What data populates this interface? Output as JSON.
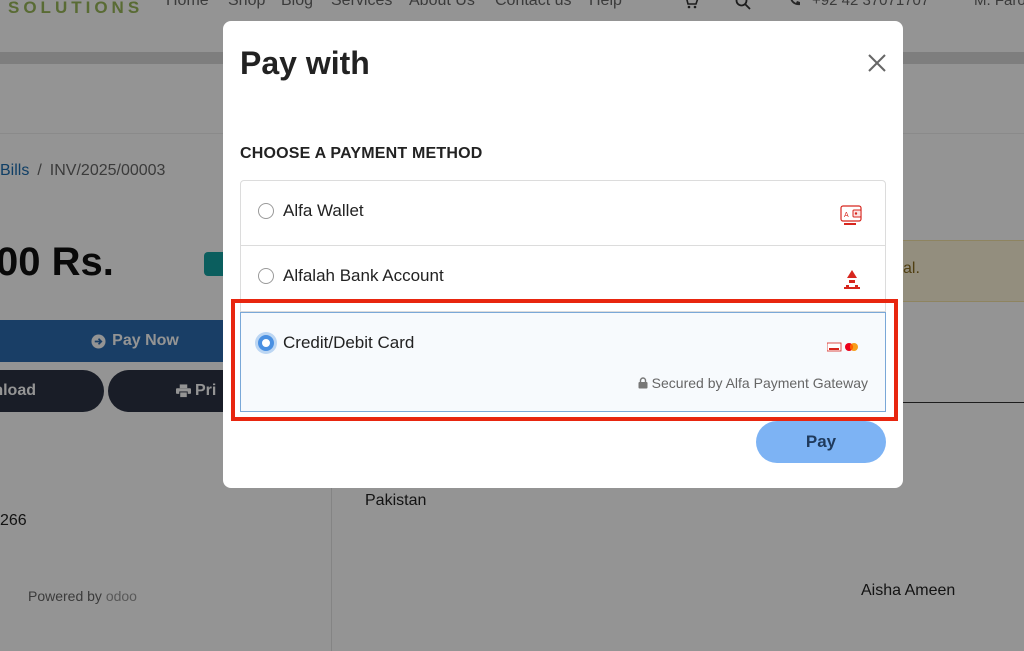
{
  "header": {
    "logo_text": "SOLUTIONS",
    "nav": [
      "Home",
      "Shop",
      "Blog",
      "Services",
      "About Us",
      "Contact us",
      "Help"
    ],
    "phone": "+92 42 37071707",
    "user": "M. Farooq"
  },
  "invoice_page": {
    "breadcrumb": {
      "parent": "Bills",
      "separator": "/",
      "current": "INV/2025/00003"
    },
    "amount": "00 Rs.",
    "pay_now_label": "Pay Now",
    "download_label": "nload",
    "print_label": "Pri",
    "phone_fragment": "266",
    "powered_by": "Powered by",
    "powered_by_brand": "odoo",
    "alert_text": "al.",
    "country": "Pakistan",
    "customer_name": "Aisha Ameen"
  },
  "modal": {
    "title": "Pay with",
    "close_icon": "close-icon",
    "section_heading": "CHOOSE A PAYMENT METHOD",
    "methods": [
      {
        "label": "Alfa Wallet",
        "selected": false,
        "logo": "alfa-wallet-logo"
      },
      {
        "label": "Alfalah Bank Account",
        "selected": false,
        "logo": "alfalah-bank-logo"
      },
      {
        "label": "Credit/Debit Card",
        "selected": true,
        "logo": "card-networks-logo"
      }
    ],
    "secured_note": "Secured by Alfa Payment Gateway",
    "pay_label": "Pay"
  },
  "colors": {
    "accent": "#4a90e2",
    "pay_button": "#7db3f4",
    "highlight": "#e8260f",
    "brand_red": "#d7261e"
  }
}
